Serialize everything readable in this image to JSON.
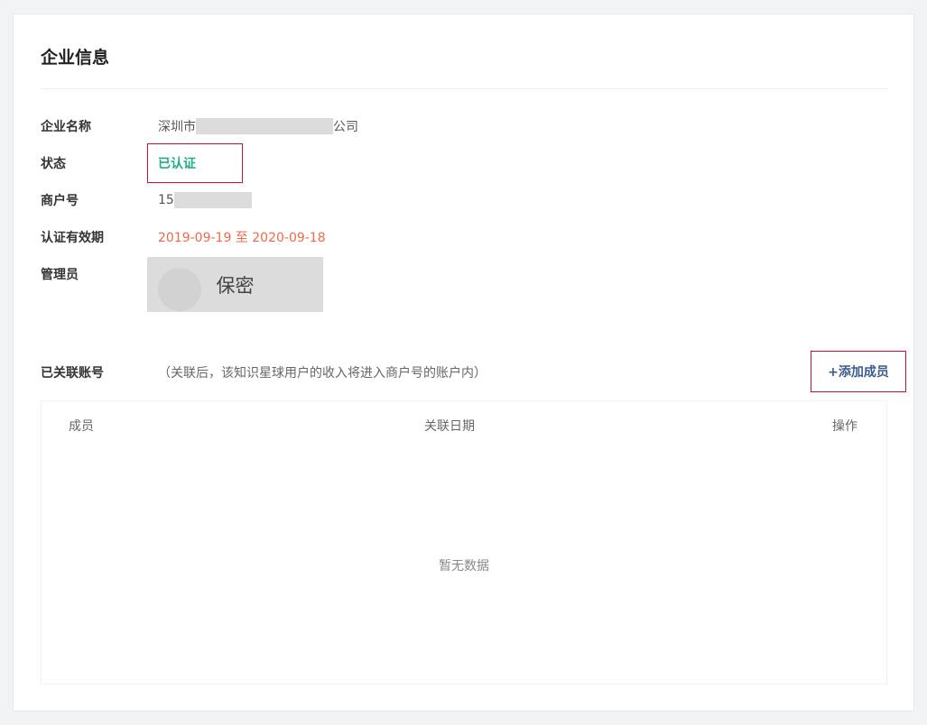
{
  "card": {
    "title": "企业信息"
  },
  "info": {
    "name_label": "企业名称",
    "name_prefix": "深圳市",
    "name_suffix": "公司",
    "status_label": "状态",
    "status_value": "已认证",
    "merchant_label": "商户号",
    "merchant_prefix": "15",
    "period_label": "认证有效期",
    "period_value": "2019-09-19 至 2020-09-18",
    "admin_label": "管理员",
    "admin_value": "保密"
  },
  "linked": {
    "label": "已关联账号",
    "note": "（关联后，该知识星球用户的收入将进入商户号的账户内）",
    "add_button": "+添加成员"
  },
  "table": {
    "columns": [
      "成员",
      "关联日期",
      "操作"
    ],
    "empty_text": "暂无数据"
  },
  "colors": {
    "status": "#1fae8a",
    "period": "#f06a4a",
    "link": "#3a5b8c",
    "highlight_border": "#c8102e"
  }
}
